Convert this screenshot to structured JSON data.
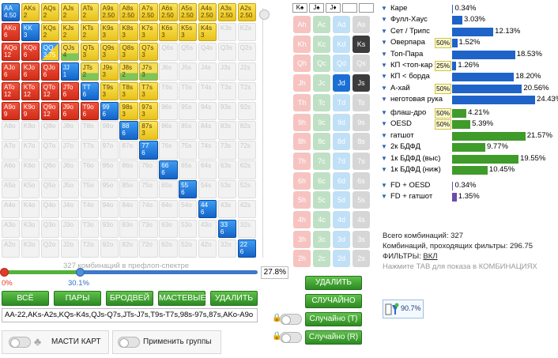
{
  "hand_grid": {
    "rows": [
      [
        "AA|4.50",
        "AKs|2",
        "AQs|2",
        "AJs|2",
        "ATs|2",
        "A9s|2.50",
        "A8s|2.50",
        "A7s|2.50",
        "A6s|2.50",
        "A5s|2.50",
        "A4s|2.50",
        "A3s|2.50",
        "A2s|2.50"
      ],
      [
        "AKo|6",
        "KK|3",
        "KQs|2",
        "KJs|2",
        "KTs|2",
        "K9s|3",
        "K8s|3",
        "K7s|3",
        "K6s|3",
        "K5s|3",
        "K4s|3",
        "K3s|",
        "K2s|"
      ],
      [
        "AQo|12",
        "KQo|6",
        "QQ|3.75",
        "QJs|4",
        "QTs|3",
        "Q9s|3",
        "Q8s|3",
        "Q7s|3",
        "Q6s|",
        "Q5s|",
        "Q4s|",
        "Q3s|",
        "Q2s|"
      ],
      [
        "AJo|6",
        "KJo|6",
        "QJo|6",
        "JJ|1",
        "JTs|2",
        "J9s|3",
        "J8s|2",
        "J7s|3",
        "J6s|",
        "J5s|",
        "J4s|",
        "J3s|",
        "J2s|"
      ],
      [
        "ATo|12",
        "KTo|12",
        "QTo|12",
        "JTo|6",
        "TT|6",
        "T9s|3",
        "T8s|3",
        "T7s|3",
        "T6s|",
        "T5s|",
        "T4s|",
        "T3s|",
        "T2s|"
      ],
      [
        "A9o|9",
        "K9o|9",
        "Q9o|12",
        "J9o|6",
        "T9o|6",
        "99|6",
        "98s|3",
        "97s|3",
        "96s|",
        "95s|",
        "94s|",
        "93s|",
        "92s|"
      ],
      [
        "A8o|",
        "K8o|",
        "Q8o|",
        "J8o|",
        "T8o|",
        "98o|",
        "88|6",
        "87s|3",
        "86s|",
        "85s|",
        "84s|",
        "83s|",
        "82s|"
      ],
      [
        "A7o|",
        "K7o|",
        "Q7o|",
        "J7o|",
        "T7o|",
        "97o|",
        "87o|",
        "77|6",
        "76s|",
        "75s|",
        "74s|",
        "73s|",
        "72s|"
      ],
      [
        "A6o|",
        "K6o|",
        "Q6o|",
        "J6o|",
        "T6o|",
        "96o|",
        "86o|",
        "76o|",
        "66|6",
        "65s|",
        "64s|",
        "63s|",
        "62s|"
      ],
      [
        "A5o|",
        "K5o|",
        "Q5o|",
        "J5o|",
        "T5o|",
        "95o|",
        "85o|",
        "75o|",
        "65o|",
        "55|6",
        "54s|",
        "53s|",
        "52s|"
      ],
      [
        "A4o|",
        "K4o|",
        "Q4o|",
        "J4o|",
        "T4o|",
        "94o|",
        "84o|",
        "74o|",
        "64o|",
        "54o|",
        "44|6",
        "43s|",
        "42s|"
      ],
      [
        "A3o|",
        "K3o|",
        "Q3o|",
        "J3o|",
        "T3o|",
        "93o|",
        "83o|",
        "73o|",
        "63o|",
        "53o|",
        "43o|",
        "33|6",
        "32s|"
      ],
      [
        "A2o|",
        "K2o|",
        "Q2o|",
        "J2o|",
        "T2o|",
        "92o|",
        "82o|",
        "72o|",
        "62o|",
        "52o|",
        "42o|",
        "32o|",
        "22|6"
      ]
    ],
    "colors": [
      [
        "blue",
        "yellow",
        "yellow",
        "yellow",
        "yellow",
        "yellow",
        "yellow",
        "yellow",
        "yellow",
        "yellow",
        "yellow",
        "yellow",
        "yellow"
      ],
      [
        "red",
        "blue",
        "yellow",
        "yellow",
        "yellow",
        "yellow",
        "yellow",
        "yellow",
        "yellow",
        "yellow",
        "yellow",
        "empty",
        "empty"
      ],
      [
        "red",
        "red",
        "bluey",
        "yellowg",
        "yellow",
        "yellow",
        "yellow",
        "yellow",
        "empty",
        "empty",
        "empty",
        "empty",
        "empty"
      ],
      [
        "red",
        "red",
        "red",
        "blue",
        "yellowg",
        "yellow",
        "yellowg",
        "yellowg",
        "empty",
        "empty",
        "empty",
        "empty",
        "empty"
      ],
      [
        "red",
        "red",
        "red",
        "red",
        "blue",
        "yellow",
        "yellow",
        "yellow",
        "empty",
        "empty",
        "empty",
        "empty",
        "empty"
      ],
      [
        "red",
        "red",
        "red",
        "red",
        "red",
        "blue",
        "yellow",
        "yellow",
        "empty",
        "empty",
        "empty",
        "empty",
        "empty"
      ],
      [
        "empty",
        "empty",
        "empty",
        "empty",
        "empty",
        "empty",
        "blue",
        "yellow",
        "empty",
        "empty",
        "empty",
        "empty",
        "empty"
      ],
      [
        "empty",
        "empty",
        "empty",
        "empty",
        "empty",
        "empty",
        "empty",
        "blue",
        "empty",
        "empty",
        "empty",
        "empty",
        "empty"
      ],
      [
        "empty",
        "empty",
        "empty",
        "empty",
        "empty",
        "empty",
        "empty",
        "empty",
        "blue",
        "empty",
        "empty",
        "empty",
        "empty"
      ],
      [
        "empty",
        "empty",
        "empty",
        "empty",
        "empty",
        "empty",
        "empty",
        "empty",
        "empty",
        "blue",
        "empty",
        "empty",
        "empty"
      ],
      [
        "empty",
        "empty",
        "empty",
        "empty",
        "empty",
        "empty",
        "empty",
        "empty",
        "empty",
        "empty",
        "blue",
        "empty",
        "empty"
      ],
      [
        "empty",
        "empty",
        "empty",
        "empty",
        "empty",
        "empty",
        "empty",
        "empty",
        "empty",
        "empty",
        "empty",
        "blue",
        "empty"
      ],
      [
        "empty",
        "empty",
        "empty",
        "empty",
        "empty",
        "empty",
        "empty",
        "empty",
        "empty",
        "empty",
        "empty",
        "empty",
        "blue"
      ]
    ]
  },
  "slider": {
    "caption": "327 комбинаций в префлоп-спектре",
    "min_label": "0%",
    "max_label": "30.1%",
    "max_value_pct": 30.1,
    "percent_box": "27.8%"
  },
  "preset_buttons": [
    "ВСЁ",
    "ПАРЫ",
    "БРОДВЕЙ",
    "МАСТЕВЫЕ",
    "УДАЛИТЬ"
  ],
  "range_text": "AA-22,AKs-A2s,KQs-K4s,QJs-Q7s,JTs-J7s,T9s-T7s,98s-97s,87s,AKo-A9o",
  "toggles": {
    "suits_label": "МАСТИ КАРТ",
    "groups_label": "Применить группы"
  },
  "suit_header": [
    "K♠",
    "J♠",
    "J♦",
    "",
    ""
  ],
  "suit_grid": [
    [
      "Ah",
      "Ac",
      "Ad",
      "As"
    ],
    [
      "Kh",
      "Kc",
      "Kd",
      "Ks"
    ],
    [
      "Qh",
      "Qc",
      "Qd",
      "Qs"
    ],
    [
      "Jh",
      "Jc",
      "Jd",
      "Js"
    ],
    [
      "Th",
      "Tc",
      "Td",
      "Ts"
    ],
    [
      "9h",
      "9c",
      "9d",
      "9s"
    ],
    [
      "8h",
      "8c",
      "8d",
      "8s"
    ],
    [
      "7h",
      "7c",
      "7d",
      "7s"
    ],
    [
      "6h",
      "6c",
      "6d",
      "6s"
    ],
    [
      "5h",
      "5c",
      "5d",
      "5s"
    ],
    [
      "4h",
      "4c",
      "4d",
      "4s"
    ],
    [
      "3h",
      "3c",
      "3d",
      "3s"
    ],
    [
      "2h",
      "2c",
      "2d",
      "2s"
    ]
  ],
  "suit_buttons": {
    "delete": "УДАЛИТЬ",
    "random": "СЛУЧАЙНО",
    "random_t": "Случайно (T)",
    "random_r": "Случайно (R)"
  },
  "stats": {
    "made_hands": [
      {
        "label": "Каре",
        "value": "0.34%",
        "pct": 0.34,
        "box": ""
      },
      {
        "label": "Фулл-Хаус",
        "value": "3.03%",
        "pct": 3.03,
        "box": ""
      },
      {
        "label": "Сет / Трипс",
        "value": "12.13%",
        "pct": 12.13,
        "box": ""
      },
      {
        "label": "Оверпара",
        "value": "1.52%",
        "pct": 1.52,
        "box": "50%"
      },
      {
        "label": "Топ-Пара",
        "value": "18.53%",
        "pct": 18.53,
        "box": ""
      },
      {
        "label": "КП <топ-кар",
        "value": "1.26%",
        "pct": 1.26,
        "box": "25%"
      },
      {
        "label": "КП < борда",
        "value": "18.20%",
        "pct": 18.2,
        "box": ""
      },
      {
        "label": "А-хай",
        "value": "20.56%",
        "pct": 20.56,
        "box": "50%"
      },
      {
        "label": "неготовая рука",
        "value": "24.43%",
        "pct": 24.43,
        "box": ""
      }
    ],
    "draws": [
      {
        "label": "флаш-дро",
        "value": "4.21%",
        "pct": 4.21,
        "box": "50%"
      },
      {
        "label": "OESD",
        "value": "5.39%",
        "pct": 5.39,
        "box": "50%"
      },
      {
        "label": "гатшот",
        "value": "21.57%",
        "pct": 21.57,
        "box": ""
      },
      {
        "label": "2к БДФД",
        "value": "9.77%",
        "pct": 9.77,
        "box": ""
      },
      {
        "label": "1к БДФД (выс)",
        "value": "19.55%",
        "pct": 19.55,
        "box": ""
      },
      {
        "label": "1к БДФД (ниж)",
        "value": "10.45%",
        "pct": 10.45,
        "box": ""
      }
    ],
    "combos": [
      {
        "label": "FD + OESD",
        "value": "0.34%",
        "pct": 0.34,
        "box": ""
      },
      {
        "label": "FD + гатшот",
        "value": "1.35%",
        "pct": 1.35,
        "box": ""
      }
    ]
  },
  "summary": {
    "total": "Всего комбинаций: 327",
    "filtered": "Комбинаций, проходящих фильтры: 296.75",
    "filters_label": "ФИЛЬТРЫ:",
    "filters_value": "ВКЛ",
    "hint": "Нажмите TAB для показа в КОМБИНАЦИЯХ"
  },
  "filter_chip": "90.7%",
  "colors": {
    "made_bar": "#1f63c8",
    "draw_bar": "#3f9b2a",
    "combo_bar": "#6a4bb0"
  }
}
